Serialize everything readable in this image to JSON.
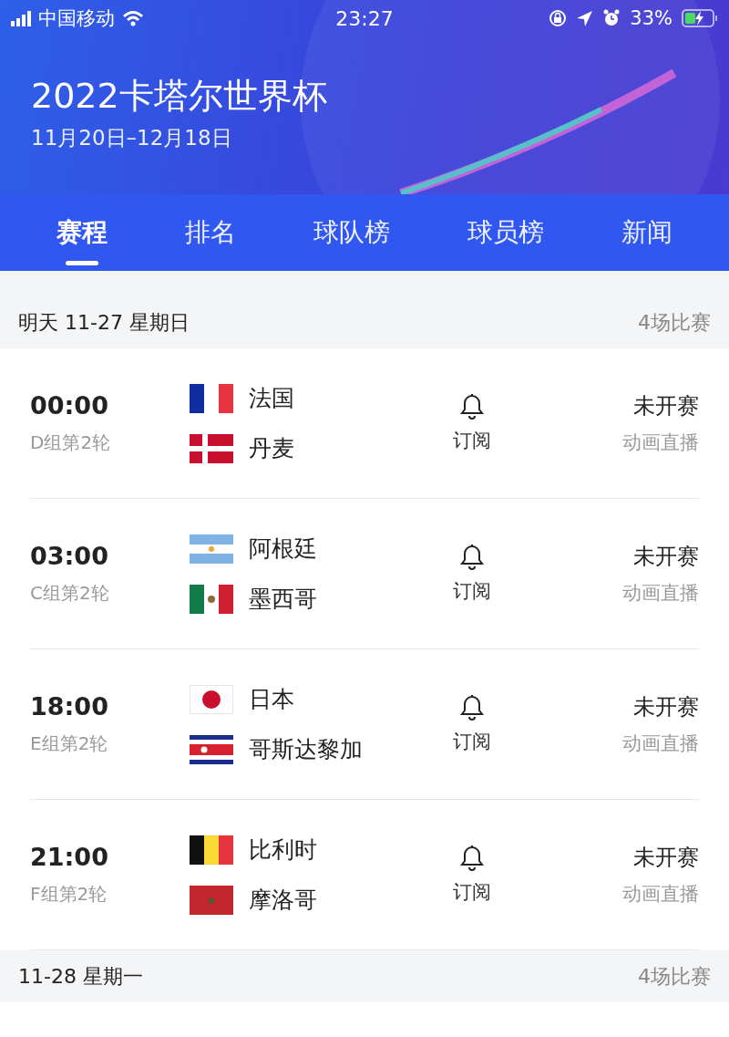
{
  "status_bar": {
    "carrier": "中国移动",
    "time": "23:27",
    "battery": "33%"
  },
  "header": {
    "title": "2022卡塔尔世界杯",
    "dates": "11月20日–12月18日"
  },
  "tabs": [
    {
      "label": "赛程",
      "selected": true
    },
    {
      "label": "排名",
      "selected": false
    },
    {
      "label": "球队榜",
      "selected": false
    },
    {
      "label": "球员榜",
      "selected": false
    },
    {
      "label": "新闻",
      "selected": false
    }
  ],
  "days": [
    {
      "date": "明天 11-27 星期日",
      "count": "4场比赛",
      "matches": [
        {
          "time": "00:00",
          "group": "D组第2轮",
          "teams": [
            "法国",
            "丹麦"
          ],
          "subscribe": "订阅",
          "status": "未开赛",
          "broadcast": "动画直播"
        },
        {
          "time": "03:00",
          "group": "C组第2轮",
          "teams": [
            "阿根廷",
            "墨西哥"
          ],
          "subscribe": "订阅",
          "status": "未开赛",
          "broadcast": "动画直播"
        },
        {
          "time": "18:00",
          "group": "E组第2轮",
          "teams": [
            "日本",
            "哥斯达黎加"
          ],
          "subscribe": "订阅",
          "status": "未开赛",
          "broadcast": "动画直播"
        },
        {
          "time": "21:00",
          "group": "F组第2轮",
          "teams": [
            "比利时",
            "摩洛哥"
          ],
          "subscribe": "订阅",
          "status": "未开赛",
          "broadcast": "动画直播"
        }
      ]
    },
    {
      "date": "11-28 星期一",
      "count": "4场比赛"
    }
  ]
}
